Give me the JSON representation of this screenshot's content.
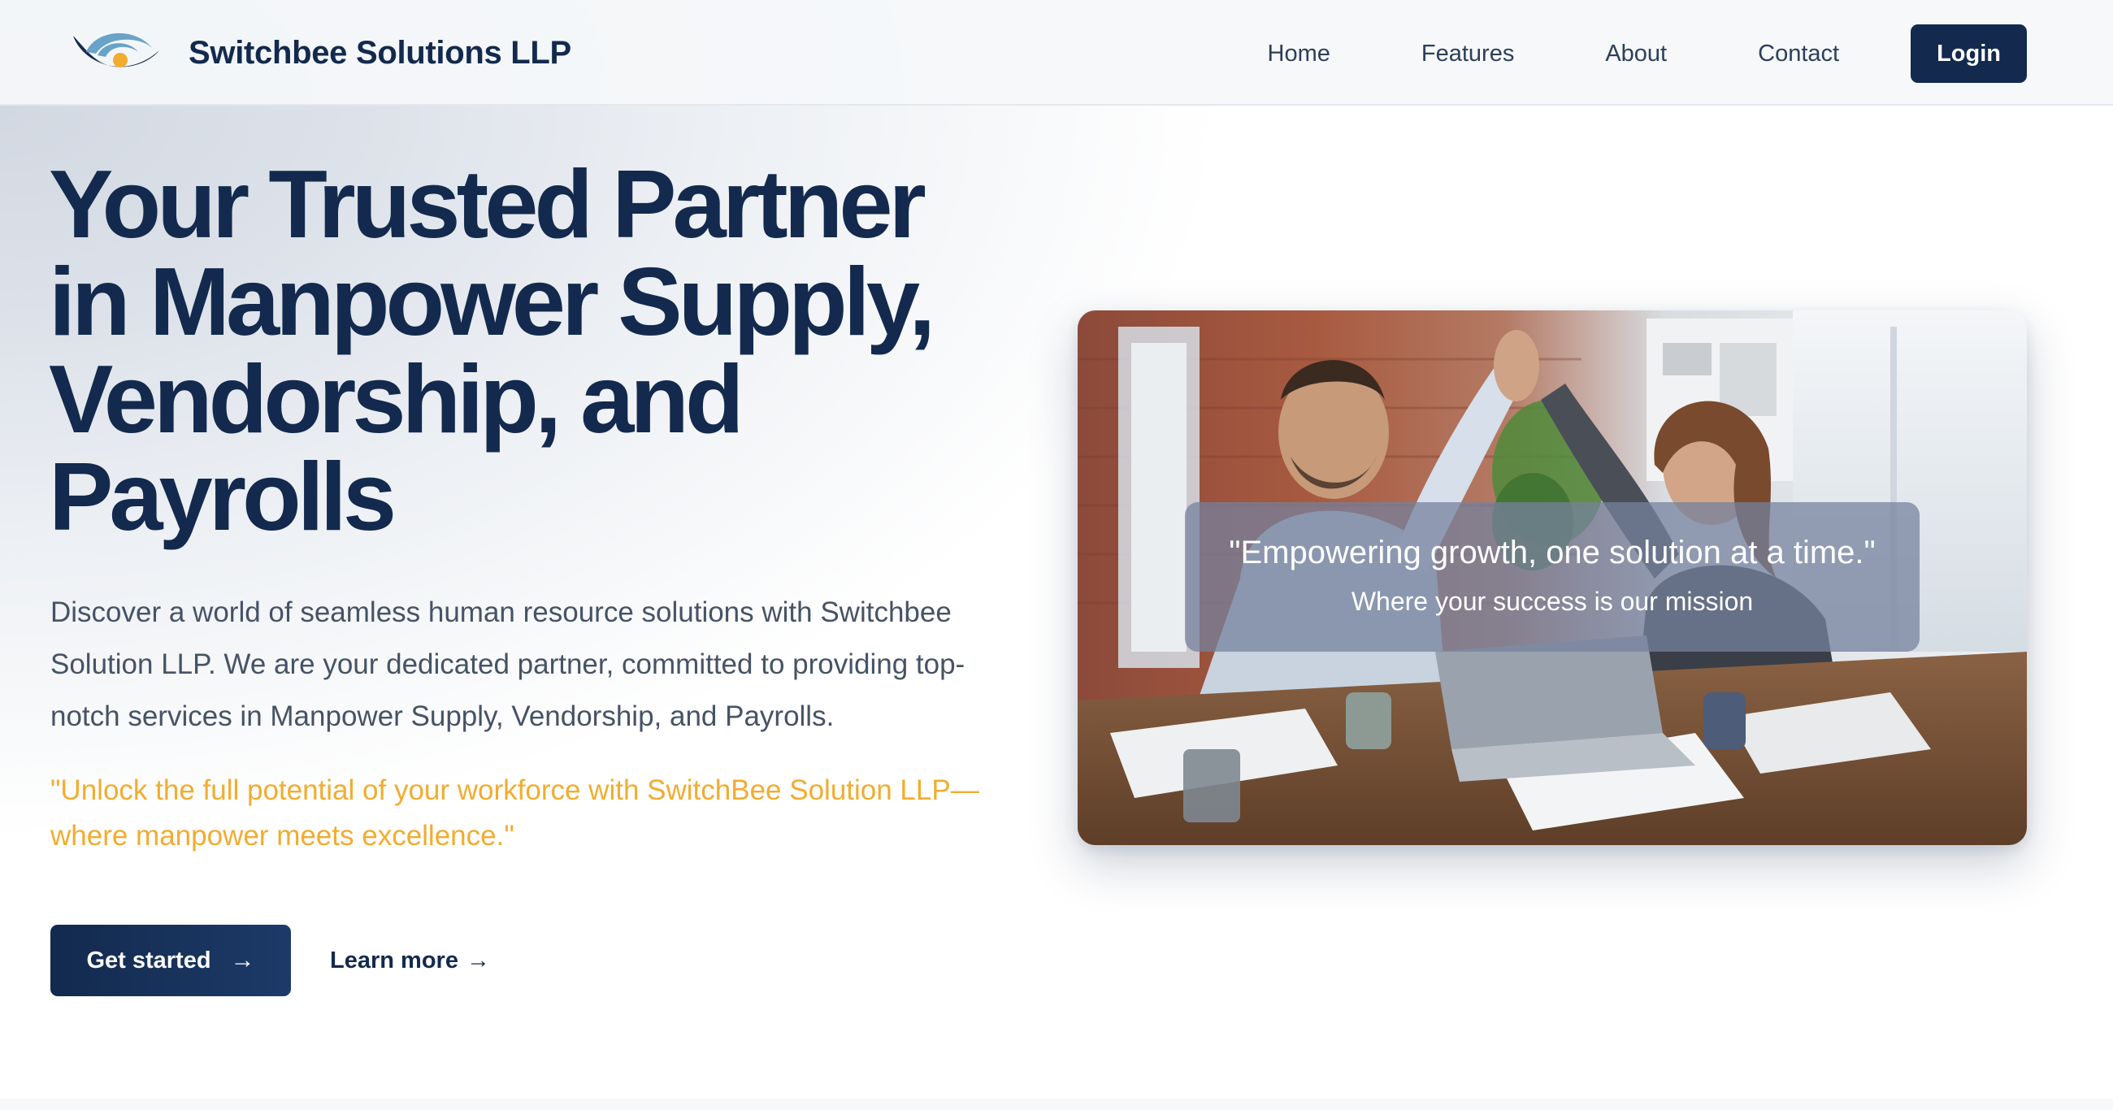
{
  "header": {
    "logo_icon": "eye-swoosh-logo-icon",
    "brand_name": "Switchbee Solutions LLP",
    "nav": {
      "home": "Home",
      "features": "Features",
      "about": "About",
      "contact": "Contact"
    },
    "login_label": "Login"
  },
  "hero": {
    "title_lines": [
      "Your Trusted Partner",
      "in Manpower Supply,",
      "Vendorship, and",
      "Payrolls"
    ],
    "description": "Discover a world of seamless human resource solutions with Switchbee Solution LLP. We are your dedicated partner, committed to providing top-notch services in Manpower Supply, Vendorship, and Payrolls.",
    "quote": "\"Unlock the full potential of your workforce with SwitchBee Solution LLP—where manpower meets excellence.\"",
    "get_started_label": "Get started",
    "get_started_icon": "arrow-right-icon",
    "learn_more_label": "Learn more",
    "learn_more_icon": "arrow-right-icon"
  },
  "image_card": {
    "photo": "business-team-high-five-office-photo",
    "overlay_quote": "\"Empowering growth, one solution at a time.\"",
    "overlay_subtitle": "Where your success is our mission"
  },
  "colors": {
    "primary": "#132a4e",
    "accent": "#f2ac2f",
    "body_text": "#465366",
    "logo_blue": "#6aa3c8"
  }
}
